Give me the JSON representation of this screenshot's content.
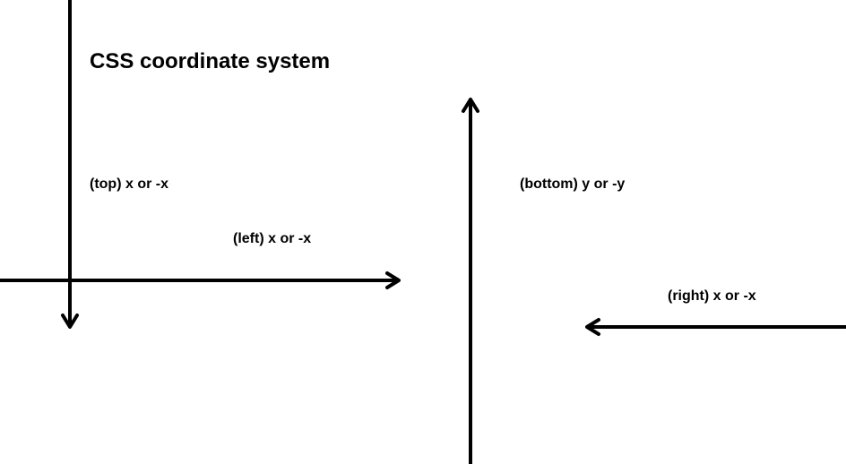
{
  "title": "CSS coordinate system",
  "labels": {
    "top": "(top)  x or -x",
    "left": "(left)  x or -x",
    "bottom": "(bottom)  y or -y",
    "right": "(right)   x or -x"
  }
}
